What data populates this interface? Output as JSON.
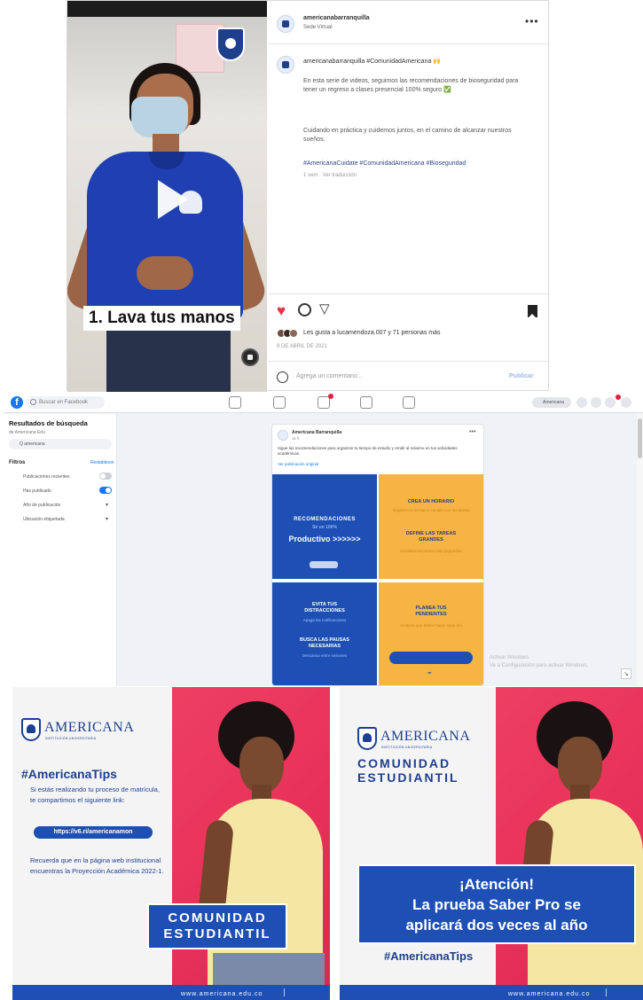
{
  "colors": {
    "instagram_heart": "#e8334b",
    "facebook_blue": "#1877f2",
    "americana_blue": "#1d4fb4",
    "americana_navy": "#1d3f8f",
    "americana_orange": "#f6b443",
    "americana_red": "#e8315a"
  },
  "instagram": {
    "username": "americanabarranquilla",
    "location": "Sede Virtual",
    "caption_line": "americanabarranquilla #ComunidadAmericana 🙌",
    "body_1": "En esta serie de videos, seguimos las recomendaciones de bioseguridad para tener un regreso a clases presencial 100% seguro ✅",
    "body_2": "Cuidando en práctica y cuidemos juntos, en el camino de alcanzar nuestros sueños.",
    "hashtags": "#AmericanaCuidate #ComunidadAmericana #Bioseguridad",
    "meta": "1 sem · Ver traducción",
    "video_caption": "1. Lava tus manos",
    "likes": "Les gusta a lucamendoza.007 y 71 personas más",
    "date": "9 DE ABRIL DE 2021",
    "comment_placeholder": "Agrega un comentario...",
    "publish_label": "Publicar",
    "icons": [
      "more-icon",
      "heart-icon",
      "comment-icon",
      "share-icon",
      "bookmark-icon",
      "play-icon",
      "mute-icon",
      "emoji-icon"
    ]
  },
  "facebook": {
    "search_placeholder": "Buscar en Facebook",
    "results_title": "Resultados de búsqueda",
    "breadcrumb": "de Americana Edu",
    "query": "Q americana",
    "filters_label": "Filtros",
    "reset_label": "Restablecer",
    "filters": [
      {
        "label": "Publicaciones recientes",
        "on": false
      },
      {
        "label": "Has publicado",
        "on": true
      },
      {
        "label": "Año de publicación",
        "select": true
      },
      {
        "label": "Ubicación etiquetada",
        "select": true
      }
    ],
    "profile_label": "Americana",
    "post": {
      "page_name": "Americana Barranquilla",
      "time": "11 h",
      "text": "Sigue las recomendaciones para organizar tu tiempo de estudio y rendir al máximo en tus actividades académicas.",
      "link_text": "Ver publicación original"
    },
    "infographic": {
      "rec_title": "RECOMENDACIONES",
      "rec_sub": "Sé un 100%",
      "productive": "Productivo >>>>>>",
      "orange_1_title": "CREA UN HORARIO",
      "orange_1_sub": "Organiza tu tiempo y cumple con tus tareas",
      "orange_2_title": "DEFINE LAS TAREAS GRANDES",
      "orange_2_sub": "Divídelas en partes más pequeñas",
      "blue_1_title": "EVITA TUS DISTRACCIONES",
      "blue_1_sub": "Apaga las notificaciones",
      "blue_2_title": "BUSCA LAS PAUSAS NECESARIAS",
      "blue_2_sub": "Descansa entre sesiones",
      "orange_3_title": "PLANEA TUS PENDIENTES",
      "orange_3_sub": "Anota lo que debes hacer cada día"
    },
    "watermark_1": "Activar Windows",
    "watermark_2": "Ve a Configuración para activar Windows."
  },
  "post_tips": {
    "brand": "AMERICANA",
    "brand_tag": "INSTITUCIÓN UNIVERSITARIA",
    "hashtag": "#AmericanaTips",
    "body_1": "Si estás realizando tu proceso de matrícula, te compartimos el siguiente link:",
    "link": "https://v6.ri/americanamon",
    "body_2": "Recuerda que en la página web institucional encuentras la Proyección Académica 2022-1.",
    "box": "COMUNIDAD ESTUDIANTIL",
    "website": "www.americana.edu.co"
  },
  "post_saber": {
    "brand": "AMERICANA",
    "brand_tag": "INSTITUCIÓN UNIVERSITARIA",
    "title": "COMUNIDAD ESTUDIANTIL",
    "box_line_1": "¡Atención!",
    "box_line_2": "La prueba Saber Pro se",
    "box_line_3": "aplicará dos veces al año",
    "hashtag": "#AmericanaTips",
    "website": "www.americana.edu.co"
  }
}
